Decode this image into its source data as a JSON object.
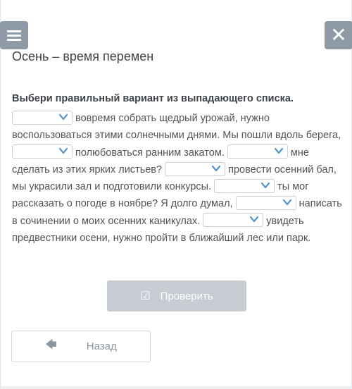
{
  "header": {
    "title": "Осень – время перемен",
    "menu_icon": "hamburger-icon",
    "close_icon": "close-icon"
  },
  "task": {
    "instruction": "Выбери правильный вариант из выпадающего списка."
  },
  "passage": {
    "t1": "вовремя собрать щедрый урожай, нужно воспользоваться этими солнечными днями. Мы пошли вдоль берега,",
    "t2": "полюбоваться ранним закатом.",
    "t3": "мне сделать из этих ярких листьев?",
    "t4": "провести осенний бал, мы украсили зал и подготовили конкурсы.",
    "t5": "ты мог рассказать о погоде в ноябре? Я долго думал,",
    "t6": "написать в сочинении о моих осенних каникулах.",
    "t7": "увидеть предвестники осени, нужно пройти в ближайший лес или парк.",
    "dropdowns": [
      "",
      "",
      "",
      "",
      "",
      "",
      ""
    ]
  },
  "buttons": {
    "check_label": "Проверить",
    "back_label": "Назад"
  },
  "colors": {
    "chevron": "#5a95c9",
    "top_button": "#8e9aa5",
    "check_button": "#c6ccd1"
  }
}
